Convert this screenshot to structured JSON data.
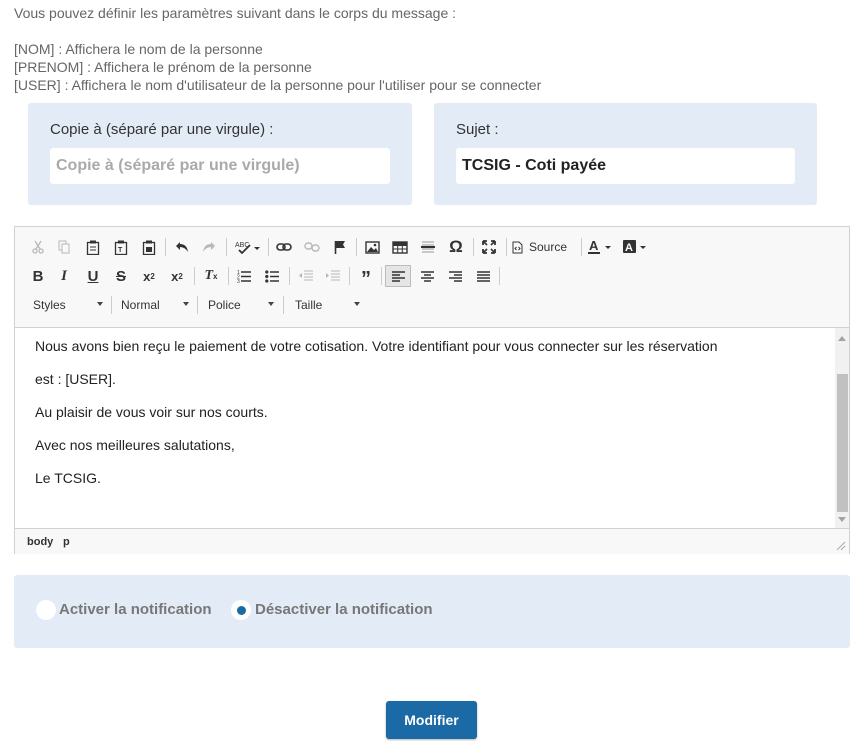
{
  "info": {
    "intro": "Vous pouvez définir les paramètres suivant dans le corps du message :",
    "params": [
      "[NOM] : Affichera le nom de la personne",
      "[PRENOM] : Affichera le prénom de la personne",
      "[USER] : Affichera le nom d'utilisateur de la personne pour l'utiliser pour se connecter"
    ]
  },
  "cc": {
    "label": "Copie à (séparé par une virgule) :",
    "placeholder": "Copie à (séparé par une virgule)",
    "value": ""
  },
  "subject": {
    "label": "Sujet :",
    "value": "TCSIG - Coti payée"
  },
  "editor": {
    "toolbar": {
      "source_label": "Source",
      "styles": "Styles",
      "format": "Normal",
      "font": "Police",
      "size": "Taille"
    },
    "content": [
      "Nous avons bien reçu le paiement de votre cotisation. Votre identifiant pour vous connecter sur les réservation",
      "est : [USER].",
      "Au plaisir de vous voir sur nos courts.",
      "Avec nos meilleures salutations,",
      "Le TCSIG."
    ],
    "path": [
      "body",
      "p"
    ]
  },
  "notification": {
    "activate_label": "Activer la notification",
    "deactivate_label": "Désactiver la notification",
    "selected": "deactivate"
  },
  "submit_label": "Modifier",
  "colors": {
    "panel": "#e3ecf6",
    "primary": "#1b6aa5"
  }
}
